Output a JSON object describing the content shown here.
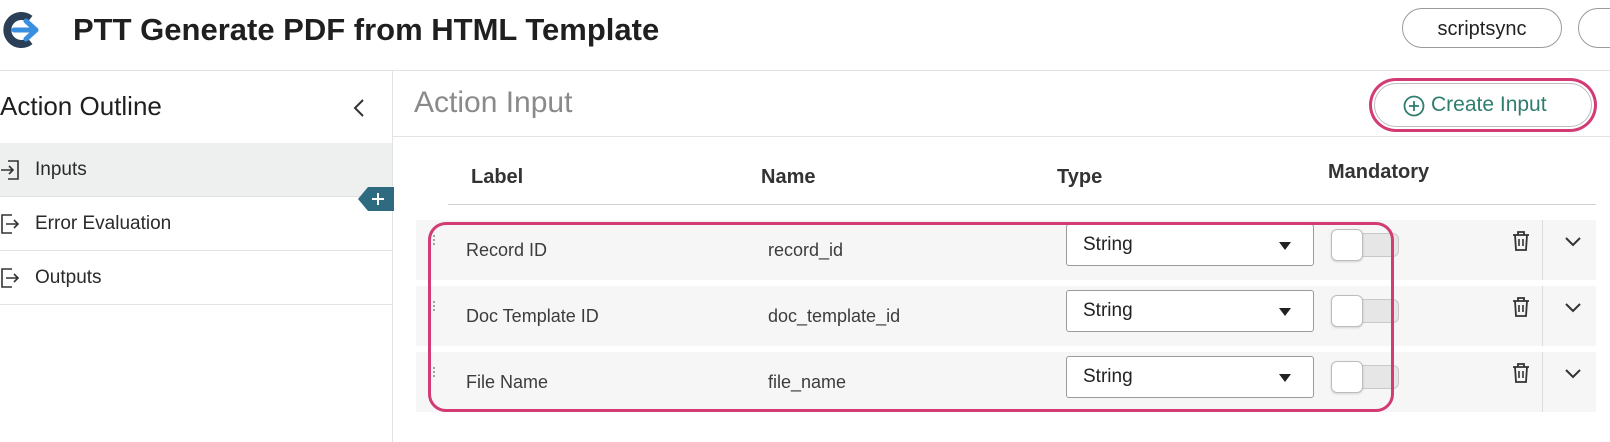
{
  "header": {
    "title": "PTT Generate PDF from HTML Template",
    "scriptsync_label": "scriptsync",
    "logo_icon": "arrow-circle-logo-icon"
  },
  "sidebar": {
    "title": "Action Outline",
    "collapse_icon": "chevron-left-icon",
    "add_icon": "plus-icon",
    "items": [
      {
        "label": "Inputs",
        "icon": "input-icon",
        "active": true
      },
      {
        "label": "Error Evaluation",
        "icon": "output-icon",
        "active": false
      },
      {
        "label": "Outputs",
        "icon": "output-icon",
        "active": false
      }
    ]
  },
  "main": {
    "title": "Action Input",
    "create_button_label": "Create Input",
    "columns": [
      "Label",
      "Name",
      "Type",
      "Mandatory"
    ],
    "rows": [
      {
        "label": "Record ID",
        "name": "record_id",
        "type": "String",
        "mandatory": false
      },
      {
        "label": "Doc Template ID",
        "name": "doc_template_id",
        "type": "String",
        "mandatory": false
      },
      {
        "label": "File Name",
        "name": "file_name",
        "type": "String",
        "mandatory": false
      }
    ]
  },
  "colors": {
    "highlight": "#d33b74",
    "accent_teal": "#2f7d6e",
    "tab_blue": "#2e6a80"
  }
}
